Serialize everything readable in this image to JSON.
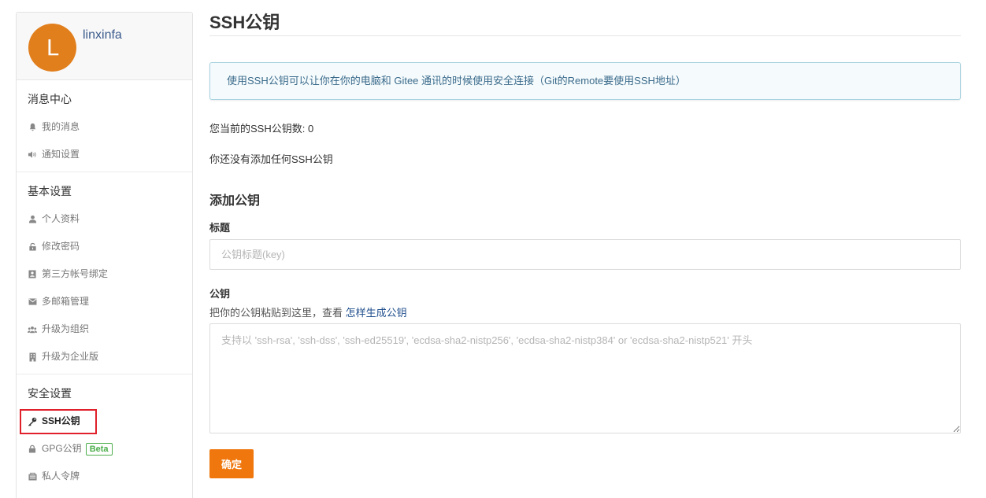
{
  "user": {
    "avatar_letter": "L",
    "name": "linxinfa"
  },
  "sidebar": {
    "sections": [
      {
        "title": "消息中心",
        "items": [
          {
            "label": "我的消息",
            "icon": "bell-icon"
          },
          {
            "label": "通知设置",
            "icon": "volume-icon"
          }
        ]
      },
      {
        "title": "基本设置",
        "items": [
          {
            "label": "个人资料",
            "icon": "user-icon"
          },
          {
            "label": "修改密码",
            "icon": "unlock-icon"
          },
          {
            "label": "第三方帐号绑定",
            "icon": "contact-card-icon"
          },
          {
            "label": "多邮箱管理",
            "icon": "envelope-icon"
          },
          {
            "label": "升级为组织",
            "icon": "users-icon"
          },
          {
            "label": "升级为企业版",
            "icon": "building-icon"
          }
        ]
      },
      {
        "title": "安全设置",
        "items": [
          {
            "label": "SSH公钥",
            "icon": "key-icon"
          },
          {
            "label": "GPG公钥",
            "icon": "lock-icon",
            "badge": "Beta"
          },
          {
            "label": "私人令牌",
            "icon": "token-icon"
          }
        ]
      }
    ]
  },
  "main": {
    "title": "SSH公钥",
    "info": "使用SSH公钥可以让你在你的电脑和 Gitee 通讯的时候使用安全连接（Git的Remote要使用SSH地址）",
    "count_text": "您当前的SSH公钥数: 0",
    "no_keys_text": "你还没有添加任何SSH公钥",
    "add_title": "添加公钥",
    "title_label": "标题",
    "title_placeholder": "公钥标题(key)",
    "key_label": "公钥",
    "key_hint": "把你的公钥粘贴到这里，查看 ",
    "key_hint_link": "怎样生成公钥",
    "key_placeholder": "支持以 'ssh-rsa', 'ssh-dss', 'ssh-ed25519', 'ecdsa-sha2-nistp256', 'ecdsa-sha2-nistp384' or 'ecdsa-sha2-nistp521' 开头",
    "submit_label": "确定"
  },
  "colors": {
    "accent": "#f0770e",
    "avatar": "#e17f1d",
    "info_border": "#a8d2e0",
    "highlight": "#e0202a",
    "badge": "#4cae4c"
  }
}
